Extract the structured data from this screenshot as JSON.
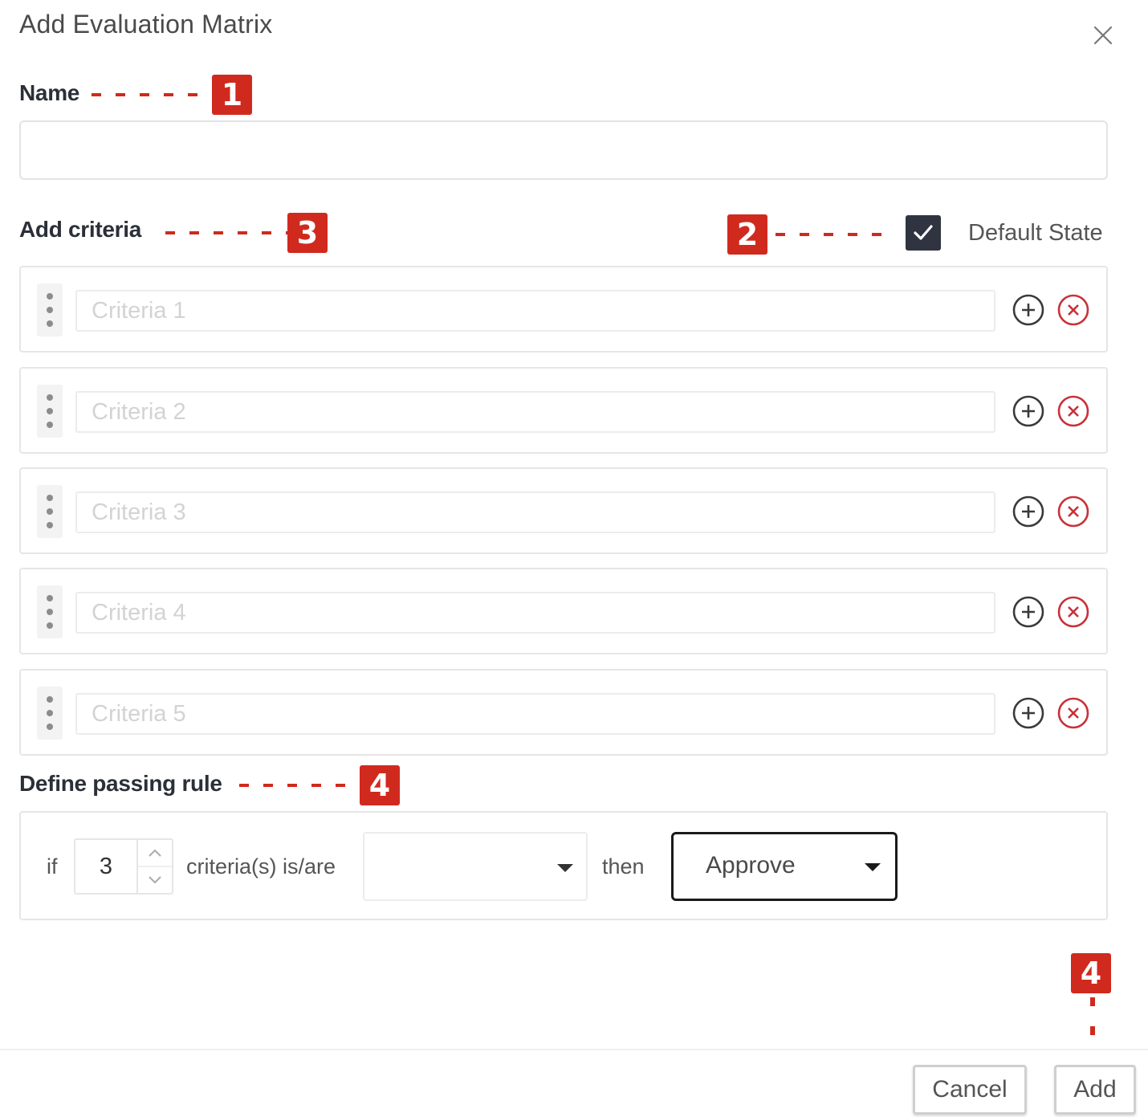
{
  "dialog": {
    "title": "Add Evaluation Matrix",
    "close_icon": "close-icon"
  },
  "name_section": {
    "label": "Name",
    "value": "",
    "placeholder": ""
  },
  "criteria_section": {
    "label": "Add criteria",
    "default_state": {
      "label": "Default State",
      "checked": true
    },
    "items": [
      {
        "placeholder": "Criteria 1",
        "value": ""
      },
      {
        "placeholder": "Criteria 2",
        "value": ""
      },
      {
        "placeholder": "Criteria 3",
        "value": ""
      },
      {
        "placeholder": "Criteria 4",
        "value": ""
      },
      {
        "placeholder": "Criteria 5",
        "value": ""
      }
    ],
    "item_icons": [
      "drag-handle-icon",
      "add-circle-icon",
      "remove-circle-icon"
    ]
  },
  "passing_rule": {
    "label": "Define passing rule",
    "if_text": "if",
    "count_value": "3",
    "criteria_text": "criteria(s) is/are",
    "condition_selected": "",
    "then_text": "then",
    "outcome_selected": "Approve"
  },
  "footer": {
    "cancel_label": "Cancel",
    "add_label": "Add"
  },
  "annotations": {
    "badge_1": "1",
    "badge_2": "2",
    "badge_3": "3",
    "badge_4": "4",
    "badge_4_footer": "4"
  },
  "colors": {
    "annotation_red": "#d02a1e",
    "checkbox_dark": "#2f3440",
    "remove_icon_red": "#c8323a"
  }
}
